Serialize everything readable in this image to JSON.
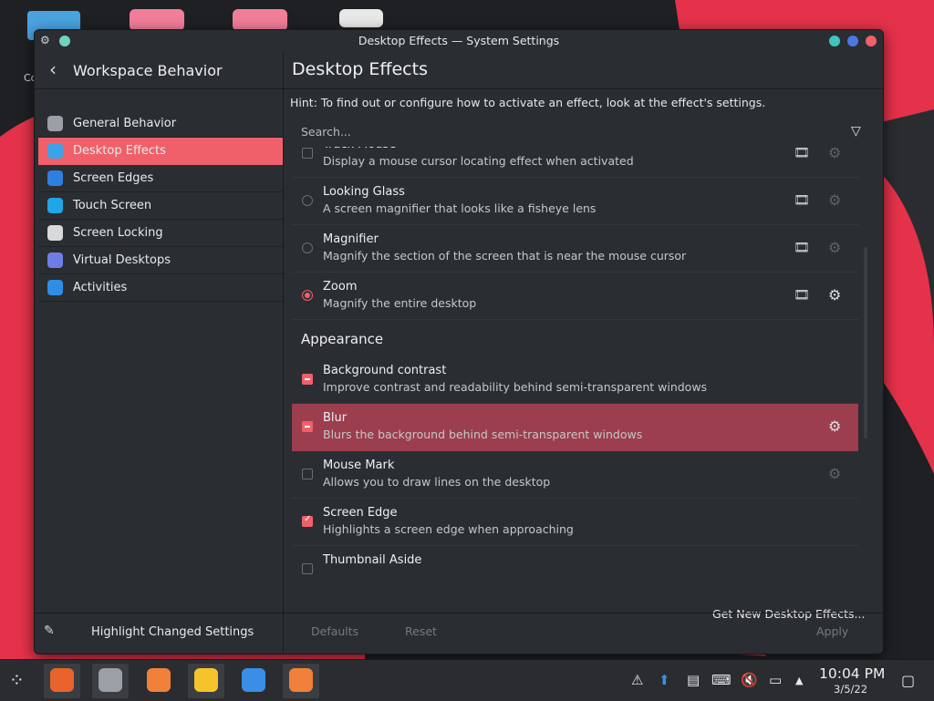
{
  "desktop": {
    "icon_label_partial": "Co"
  },
  "window": {
    "title": "Desktop Effects — System Settings",
    "sidebar": {
      "title": "Workspace Behavior",
      "items": [
        {
          "label": "General Behavior",
          "icon": "general-behavior-icon",
          "color": "#9aa0a6"
        },
        {
          "label": "Desktop Effects",
          "icon": "desktop-effects-icon",
          "color": "#3ba3e8",
          "active": true
        },
        {
          "label": "Screen Edges",
          "icon": "screen-edges-icon",
          "color": "#2f7fe0"
        },
        {
          "label": "Touch Screen",
          "icon": "touch-screen-icon",
          "color": "#1fa6e6"
        },
        {
          "label": "Screen Locking",
          "icon": "lock-icon",
          "color": "#d7d9db"
        },
        {
          "label": "Virtual Desktops",
          "icon": "virtual-desktops-icon",
          "color": "#6f7ee6"
        },
        {
          "label": "Activities",
          "icon": "activities-icon",
          "color": "#2d8ee6"
        }
      ],
      "footer_label": "Highlight Changed Settings"
    },
    "main": {
      "title": "Desktop Effects",
      "hint": "Hint: To find out or configure how to activate an effect, look at the effect's settings.",
      "search_placeholder": "Search...",
      "effects_top": [
        {
          "name": "Track Mouse",
          "desc": "Display a mouse cursor locating effect when activated",
          "control": "checkbox",
          "state": "off",
          "video": true,
          "configurable": false
        },
        {
          "name": "Looking Glass",
          "desc": "A screen magnifier that looks like a fisheye lens",
          "control": "radio",
          "state": "off",
          "video": true,
          "configurable": false
        },
        {
          "name": "Magnifier",
          "desc": "Magnify the section of the screen that is near the mouse cursor",
          "control": "radio",
          "state": "off",
          "video": true,
          "configurable": false
        },
        {
          "name": "Zoom",
          "desc": "Magnify the entire desktop",
          "control": "radio",
          "state": "on",
          "video": true,
          "configurable": true
        }
      ],
      "section_appearance": "Appearance",
      "effects_appearance": [
        {
          "name": "Background contrast",
          "desc": "Improve contrast and readability behind semi-transparent windows",
          "control": "checkbox",
          "state": "partial",
          "video": false,
          "configurable": false
        },
        {
          "name": "Blur",
          "desc": "Blurs the background behind semi-transparent windows",
          "control": "checkbox",
          "state": "partial",
          "video": false,
          "configurable": true,
          "highlighted": true
        },
        {
          "name": "Mouse Mark",
          "desc": "Allows you to draw lines on the desktop",
          "control": "checkbox",
          "state": "off",
          "video": false,
          "configurable": false
        },
        {
          "name": "Screen Edge",
          "desc": "Highlights a screen edge when approaching",
          "control": "checkbox",
          "state": "on",
          "video": false,
          "configurable": false
        },
        {
          "name": "Thumbnail Aside",
          "desc": "",
          "control": "checkbox",
          "state": "off",
          "video": false,
          "configurable": false
        }
      ],
      "get_new": "Get New Desktop Effects...",
      "buttons": {
        "defaults": "Defaults",
        "reset": "Reset",
        "apply": "Apply"
      }
    }
  },
  "taskbar": {
    "apps": [
      {
        "name": "firefox-icon",
        "color": "#e8642c",
        "active": true
      },
      {
        "name": "system-settings-icon",
        "color": "#9aa0a6",
        "active": true
      },
      {
        "name": "discover-store-icon",
        "color": "#f0803a",
        "active": false
      },
      {
        "name": "files-icon",
        "color": "#f5c32c",
        "active": true
      },
      {
        "name": "kde-connect-icon",
        "color": "#3a8ee6",
        "active": false
      },
      {
        "name": "discover-update-icon",
        "color": "#f0803a",
        "active": true
      }
    ],
    "time": "10:04 PM",
    "date": "3/5/22"
  },
  "colors": {
    "accent": "#f0606a",
    "highlight_row": "#9c3e4d",
    "window_bg": "#2a2e32"
  }
}
